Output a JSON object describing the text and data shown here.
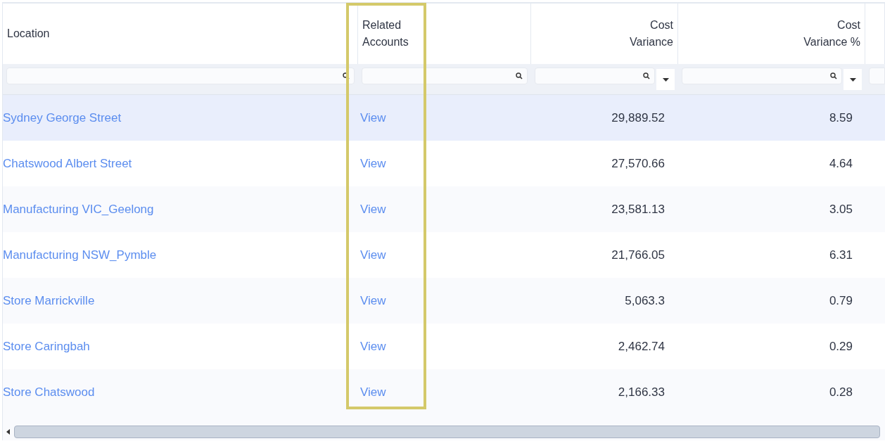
{
  "table": {
    "columns": [
      {
        "label": "Location",
        "kind": "text"
      },
      {
        "label": "Related Accounts",
        "kind": "link"
      },
      {
        "label": "Cost Variance",
        "kind": "number"
      },
      {
        "label": "Cost Variance %",
        "kind": "number"
      }
    ],
    "rows": [
      {
        "location": "Sydney George Street",
        "link": "View",
        "cost_variance": "29,889.52",
        "cost_variance_pct": "8.59",
        "selected": true
      },
      {
        "location": "Chatswood Albert Street",
        "link": "View",
        "cost_variance": "27,570.66",
        "cost_variance_pct": "4.64",
        "selected": false
      },
      {
        "location": "Manufacturing VIC_Geelong",
        "link": "View",
        "cost_variance": "23,581.13",
        "cost_variance_pct": "3.05",
        "selected": false
      },
      {
        "location": "Manufacturing NSW_Pymble",
        "link": "View",
        "cost_variance": "21,766.05",
        "cost_variance_pct": "6.31",
        "selected": false
      },
      {
        "location": "Store Marrickville",
        "link": "View",
        "cost_variance": "5,063.3",
        "cost_variance_pct": "0.79",
        "selected": false
      },
      {
        "location": "Store Caringbah",
        "link": "View",
        "cost_variance": "2,462.74",
        "cost_variance_pct": "0.29",
        "selected": false
      },
      {
        "location": "Store Chatswood",
        "link": "View",
        "cost_variance": "2,166.33",
        "cost_variance_pct": "0.28",
        "selected": false
      }
    ]
  }
}
